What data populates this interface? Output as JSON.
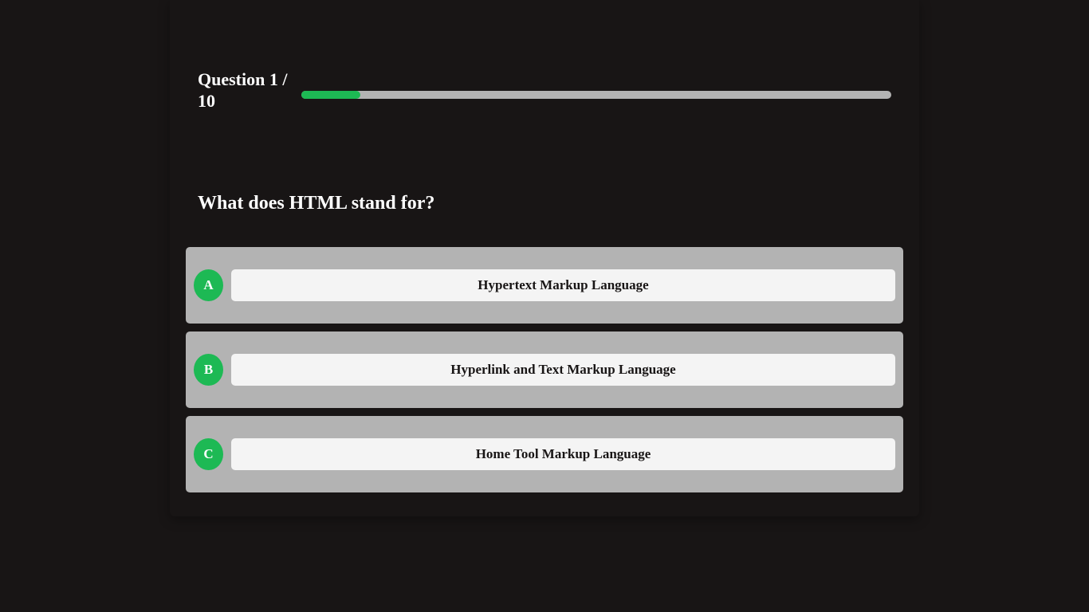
{
  "progress": {
    "counter_line1": "Question 1 /",
    "counter_line2": "10",
    "current": 1,
    "total": 10,
    "fill_fraction": 0.1
  },
  "question": {
    "text": "What does HTML stand for?"
  },
  "answers": [
    {
      "letter": "A",
      "text": "Hypertext Markup Language"
    },
    {
      "letter": "B",
      "text": "Hyperlink and Text Markup Language"
    },
    {
      "letter": "C",
      "text": "Home Tool Markup Language"
    }
  ],
  "colors": {
    "background": "#181515",
    "accent": "#1db954",
    "answer_bg": "#b3b3b3",
    "answer_text_bg": "#f4f4f4",
    "text_light": "#ffffff",
    "text_dark": "#181515"
  }
}
